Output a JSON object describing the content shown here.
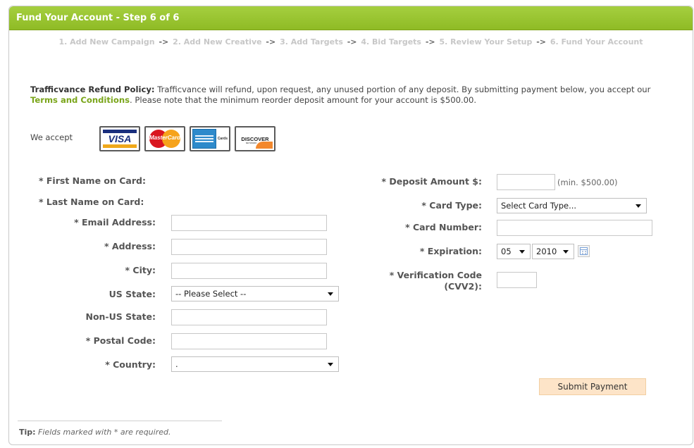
{
  "header": {
    "title": "Fund Your Account - Step 6 of 6"
  },
  "steps": [
    "1. Add New Campaign",
    "2. Add New Creative",
    "3. Add Targets",
    "4. Bid Targets",
    "5. Review Your Setup",
    "6. Fund Your Account"
  ],
  "step_arrow": "->",
  "policy": {
    "label": "Trafficvance Refund Policy:",
    "text1": " Trafficvance will refund, upon request, any unused portion of any deposit.  By submitting payment below, you accept our ",
    "link": "Terms and Conditions",
    "text2": ".  Please note that the minimum reorder deposit amount for your account is $500.00."
  },
  "payment": {
    "we_accept": "We accept",
    "cards": [
      {
        "name": "VISA",
        "icon": "visa-card-icon"
      },
      {
        "name": "MasterCard",
        "icon": "mastercard-card-icon"
      },
      {
        "name": "American Express",
        "icon": "amex-card-icon"
      },
      {
        "name": "DISCOVER",
        "icon": "discover-card-icon"
      }
    ]
  },
  "form": {
    "left": {
      "first_name_label": "* First Name on Card:",
      "last_name_label": "* Last Name on Card:",
      "email_label": "* Email Address:",
      "address_label": "* Address:",
      "city_label": "* City:",
      "us_state_label": "US State:",
      "us_state_value": "-- Please Select --",
      "non_us_state_label": "Non-US State:",
      "postal_code_label": "* Postal Code:",
      "country_label": "* Country:",
      "country_value": "."
    },
    "right": {
      "deposit_label": "* Deposit Amount $:",
      "deposit_note": "(min. $500.00)",
      "card_type_label": "* Card Type:",
      "card_type_value": "Select Card Type...",
      "card_number_label": "* Card Number:",
      "expiration_label": "* Expiration:",
      "exp_month": "05",
      "exp_year": "2010",
      "cvv_label_line1": "* Verification Code",
      "cvv_label_line2": "(CVV2):"
    },
    "submit": "Submit Payment"
  },
  "tip": {
    "label": "Tip:",
    "text": " Fields marked with * are required."
  },
  "colors": {
    "header": "#97c22f",
    "link": "#7aa51a",
    "submit_bg": "#fde4c8"
  }
}
